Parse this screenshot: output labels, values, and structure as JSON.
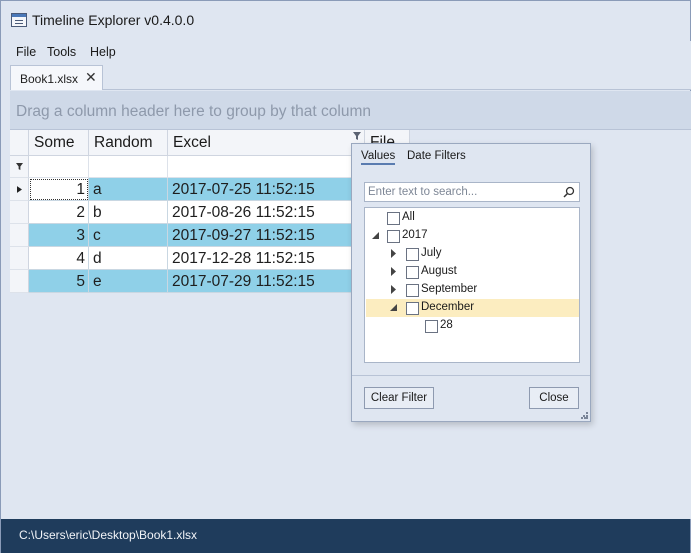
{
  "window": {
    "title": "Timeline Explorer v0.4.0.0"
  },
  "menu": [
    {
      "label": "File"
    },
    {
      "label": "Tools"
    },
    {
      "label": "Help"
    }
  ],
  "document_tab": {
    "label": "Book1.xlsx",
    "close_glyph": "✕"
  },
  "group_panel": {
    "hint": "Drag a column header here to group by that column"
  },
  "columns": [
    {
      "label": "Some"
    },
    {
      "label": "Random"
    },
    {
      "label": "Excel"
    },
    {
      "label": "File"
    }
  ],
  "rows": [
    {
      "some": "1",
      "random": "a",
      "excel": "2017-07-25 11:52:15"
    },
    {
      "some": "2",
      "random": "b",
      "excel": "2017-08-26 11:52:15"
    },
    {
      "some": "3",
      "random": "c",
      "excel": "2017-09-27 11:52:15"
    },
    {
      "some": "4",
      "random": "d",
      "excel": "2017-12-28 11:52:15"
    },
    {
      "some": "5",
      "random": "e",
      "excel": "2017-07-29 11:52:15"
    }
  ],
  "filter_popup": {
    "tabs": [
      {
        "label": "Values",
        "active": true
      },
      {
        "label": "Date Filters",
        "active": false
      }
    ],
    "search": {
      "placeholder": "Enter text to search...",
      "value": ""
    },
    "tree": [
      {
        "label": "All",
        "checked": false
      },
      {
        "label": "2017",
        "checked": false,
        "expanded": true
      },
      {
        "label": "July",
        "checked": false,
        "expanded": false
      },
      {
        "label": "August",
        "checked": false,
        "expanded": false
      },
      {
        "label": "September",
        "checked": false,
        "expanded": false
      },
      {
        "label": "December",
        "checked": false,
        "expanded": true,
        "selected": true
      },
      {
        "label": "28",
        "checked": false
      }
    ],
    "clear_label": "Clear Filter",
    "close_label": "Close"
  },
  "status": {
    "path": "C:\\Users\\eric\\Desktop\\Book1.xlsx"
  },
  "colors": {
    "row_highlight": "#8fd0e8",
    "statusbar": "#1f3c5c",
    "selected_node": "#fcedc0",
    "chrome": "#dfe6f1"
  },
  "icons": {
    "app": "app-window-icon",
    "filter": "funnel-icon",
    "search": "magnifier-icon",
    "row_indicator": "current-row-arrow-icon"
  }
}
